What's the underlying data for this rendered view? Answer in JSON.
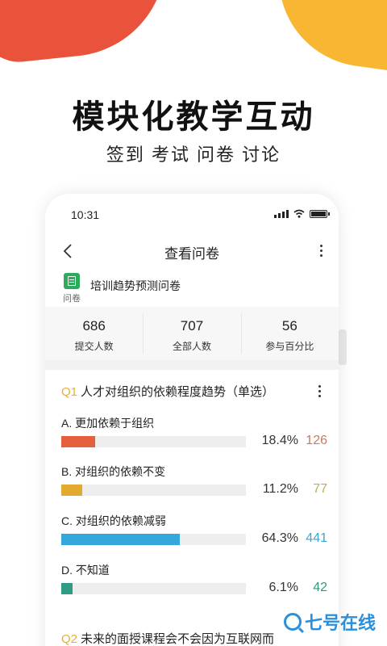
{
  "headline": "模块化教学互动",
  "subline": "签到 考试 问卷 讨论",
  "status_bar": {
    "time": "10:31"
  },
  "nav": {
    "title": "查看问卷"
  },
  "survey": {
    "icon_label": "问卷",
    "title": "培训趋势预测问卷"
  },
  "stats": [
    {
      "value": "686",
      "label": "提交人数"
    },
    {
      "value": "707",
      "label": "全部人数"
    },
    {
      "value": "56",
      "label": "参与百分比"
    }
  ],
  "questions": [
    {
      "num": "Q1",
      "text": "人才对组织的依赖程度趋势（单选）",
      "options": [
        {
          "label": "A. 更加依赖于组织",
          "pct_text": "18.4%",
          "pct": 18.4,
          "count": "126",
          "color": "#e5603c",
          "count_color": "#c9785e"
        },
        {
          "label": "B. 对组织的依赖不变",
          "pct_text": "11.2%",
          "pct": 11.2,
          "count": "77",
          "color": "#e2ab2f",
          "count_color": "#bdb14a"
        },
        {
          "label": "C. 对组织的依赖减弱",
          "pct_text": "64.3%",
          "pct": 64.3,
          "count": "441",
          "color": "#35a7da",
          "count_color": "#3aa3cf"
        },
        {
          "label": "D. 不知道",
          "pct_text": "6.1%",
          "pct": 6.1,
          "count": "42",
          "color": "#2e9b83",
          "count_color": "#2f9a82"
        }
      ]
    },
    {
      "num": "Q2",
      "text": "未来的面授课程会不会因为互联网而"
    }
  ],
  "watermark": {
    "text": "七号在线"
  }
}
